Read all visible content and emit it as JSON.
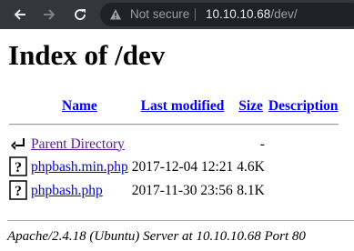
{
  "browser": {
    "security_label": "Not secure",
    "url_host": "10.10.10.68",
    "url_path": "/dev/"
  },
  "page": {
    "title": "Index of /dev"
  },
  "table": {
    "headers": {
      "name": "Name",
      "last_modified": "Last modified",
      "size": "Size",
      "description": "Description"
    },
    "parent": {
      "label": "Parent Directory",
      "size": "-"
    },
    "rows": [
      {
        "name": "phpbash.min.php",
        "modified": "2017-12-04 12:21",
        "size": "4.6K",
        "icon": "unknown-file-icon"
      },
      {
        "name": "phpbash.php",
        "modified": "2017-11-30 23:56",
        "size": "8.1K",
        "icon": "unknown-file-icon"
      }
    ]
  },
  "footer": {
    "text": "Apache/2.4.18 (Ubuntu) Server at 10.10.10.68 Port 80"
  },
  "colors": {
    "toolbar": "#35363a",
    "omnibox": "#202124",
    "link": "#0000ee",
    "visited_link": "#551a8b"
  }
}
